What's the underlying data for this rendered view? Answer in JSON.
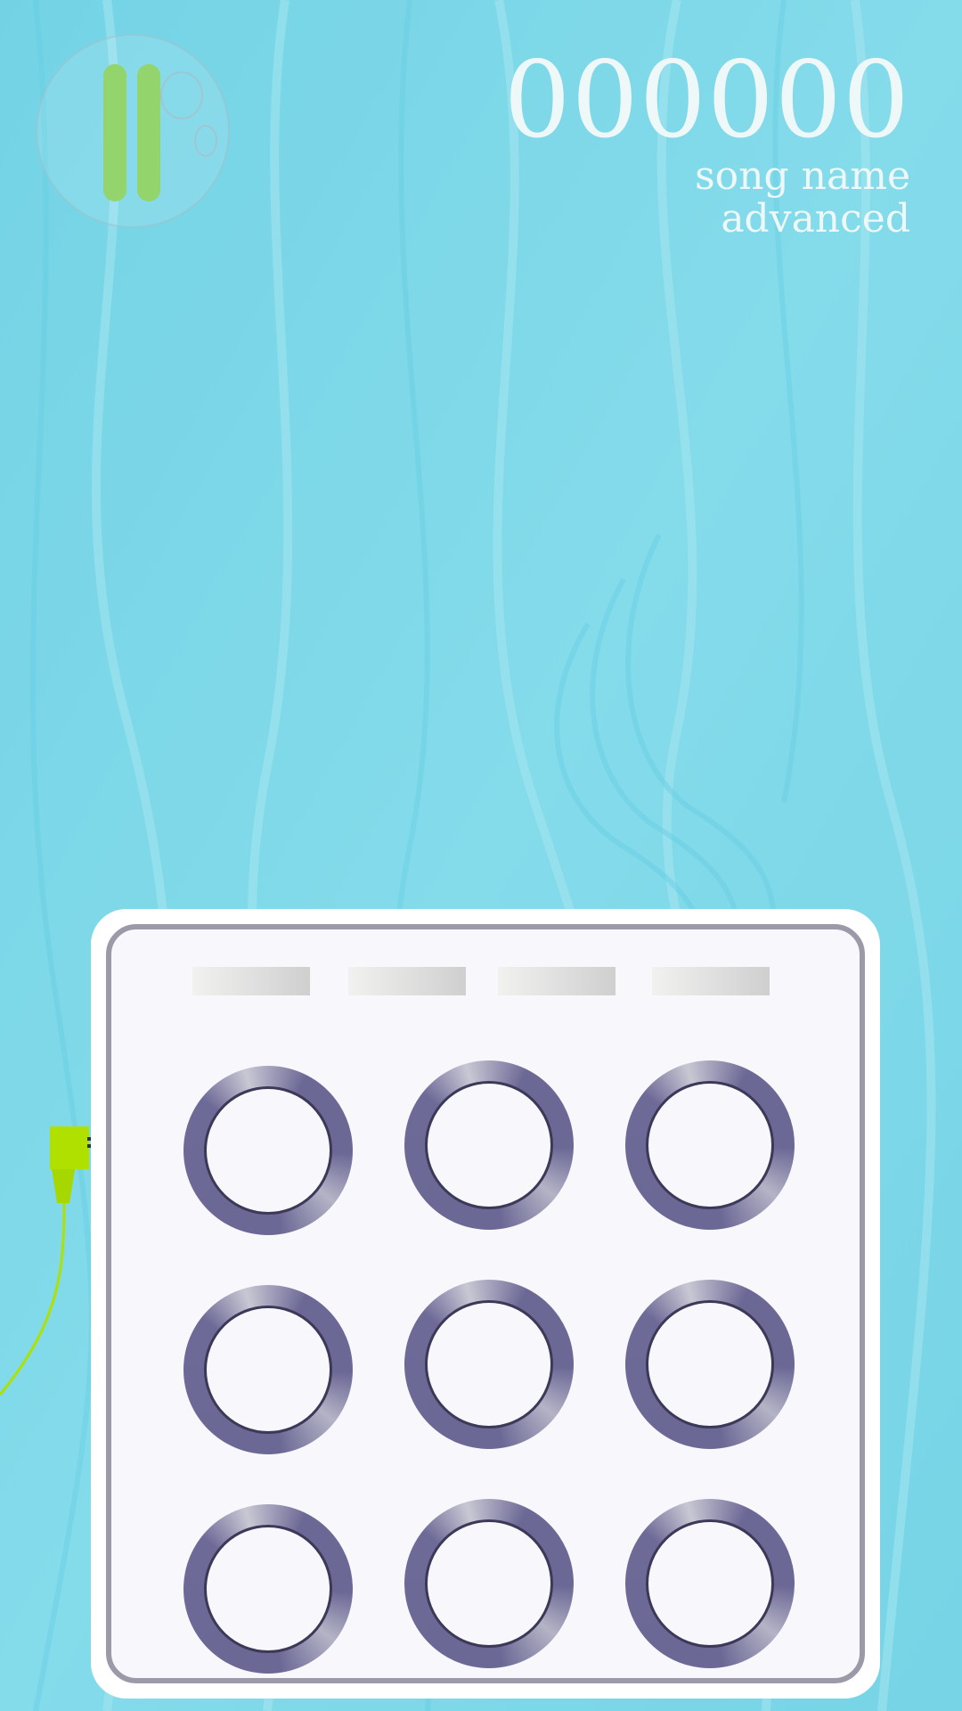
{
  "hud": {
    "score": "000000",
    "song_name": "song name",
    "difficulty": "advanced"
  },
  "pause": {
    "icon": "pause-icon",
    "color": "#93d46c"
  },
  "pad_grid": {
    "rows": 3,
    "cols": 3,
    "indicators": 4,
    "ring_color": "#6c6896",
    "face_color": "#f8f8fc"
  },
  "cable": {
    "color": "#b0e000"
  },
  "colors": {
    "background": "#78d6e6",
    "text": "#eef8f8"
  }
}
